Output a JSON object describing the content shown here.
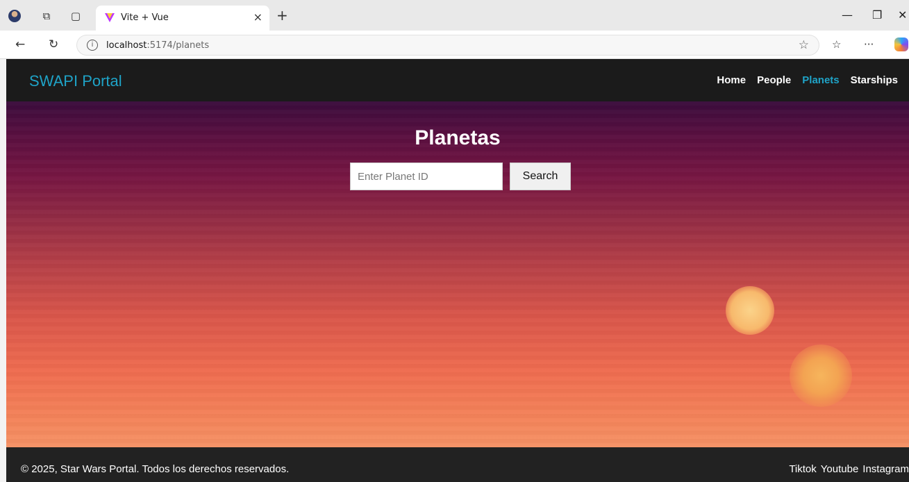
{
  "browser": {
    "tab_title": "Vite + Vue",
    "tab_close": "×",
    "new_tab": "+",
    "url_host": "localhost",
    "url_path": ":5174/planets",
    "icons": [
      "profile-avatar",
      "workspaces-icon",
      "tab-actions-icon",
      "vite-logo",
      "back-icon",
      "refresh-icon",
      "info-icon",
      "favorite-star-icon",
      "favorites-icon",
      "more-icon",
      "copilot-icon"
    ]
  },
  "navbar": {
    "brand": "SWAPI Portal",
    "links": [
      {
        "label": "Home",
        "active": false
      },
      {
        "label": "People",
        "active": false
      },
      {
        "label": "Planets",
        "active": true
      },
      {
        "label": "Starships",
        "active": false
      }
    ],
    "accent_color": "#1fa3c7"
  },
  "main": {
    "title": "Planetas",
    "search": {
      "placeholder": "Enter Planet ID",
      "value": "",
      "button_label": "Search"
    }
  },
  "footer": {
    "copyright": "© 2025, Star Wars Portal. Todos los derechos reservados.",
    "social": [
      "Tiktok",
      "Youtube",
      "Instagram"
    ]
  }
}
